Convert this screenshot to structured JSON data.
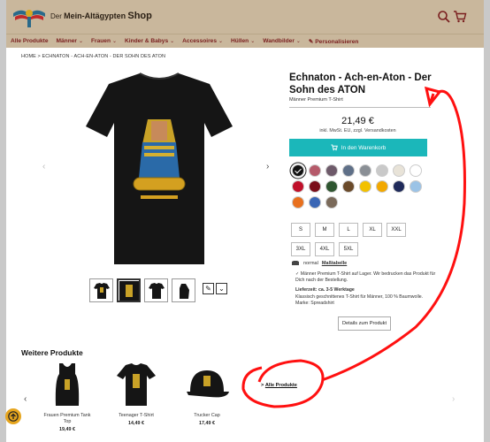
{
  "header": {
    "shop_prefix": "Der",
    "shop_name": "Mein-Altägypten",
    "shop_suffix": "Shop",
    "logo_icon": "winged-sun-logo",
    "search_icon": "search-icon",
    "cart_icon": "cart-icon"
  },
  "nav": {
    "items": [
      {
        "label": "Alle Produkte",
        "has_menu": false
      },
      {
        "label": "Männer",
        "has_menu": true
      },
      {
        "label": "Frauen",
        "has_menu": true
      },
      {
        "label": "Kinder & Babys",
        "has_menu": true
      },
      {
        "label": "Accessoires",
        "has_menu": true
      },
      {
        "label": "Hüllen",
        "has_menu": true
      },
      {
        "label": "Wandbilder",
        "has_menu": true
      },
      {
        "label": "✎ Personalisieren",
        "has_menu": false
      }
    ]
  },
  "breadcrumb": "HOME  >  ECHNATON - ACH-EN-ATON - DER SOHN DES ATON",
  "product": {
    "title": "Echnaton - Ach-en-Aton - Der Sohn des ATON",
    "subtitle": "Männer Premium T-Shirt",
    "price": "21,49 €",
    "tax_note": "inkl. MwSt. EU, zzgl. Versandkosten",
    "cart_button": "In den Warenkorb",
    "colors": [
      "#111111",
      "#b55a6a",
      "#6e5a6a",
      "#5f7088",
      "#8a8f95",
      "#c9c9c9",
      "#e8e3d8",
      "#ffffff",
      "#c0102a",
      "#7a0e1a",
      "#2e5530",
      "#6a4a2a",
      "#f2c100",
      "#f2a800",
      "#1f2a5a",
      "#9bc3e6",
      "#e8701e",
      "#3a66b5",
      "#7a6a5a"
    ],
    "selected_color_index": 0,
    "sizes": [
      "S",
      "M",
      "L",
      "XL",
      "XXL",
      "3XL",
      "4XL",
      "5XL"
    ],
    "fit_label": "normal",
    "size_guide": "Maßtabelle",
    "stock_text": "✓ Männer Premium T-Shirt auf Lager. Wir bedrucken das Produkt für Dich nach der Bestellung.",
    "delivery_label": "Lieferzeit: ca. 3-5 Werktage",
    "description": "Klassisch geschnittenes T-Shirt für Männer, 100 % Baumwolle.",
    "brand": "Marke: Spreadshirt",
    "details_button": "Details zum Produkt"
  },
  "more": {
    "title": "Weitere Produkte",
    "items": [
      {
        "name": "Frauen Premium Tank Top",
        "price": "19,49 €"
      },
      {
        "name": "Teenager T-Shirt",
        "price": "14,49 €"
      },
      {
        "name": "Trucker Cap",
        "price": "17,49 €"
      }
    ],
    "all_link_prefix": ">",
    "all_link": "Alle Produkte"
  },
  "colors": {
    "header_bg": "#c9b79c",
    "nav_text": "#7a1f1f",
    "accent": "#1bb7ba",
    "annotation": "#ff1010"
  }
}
